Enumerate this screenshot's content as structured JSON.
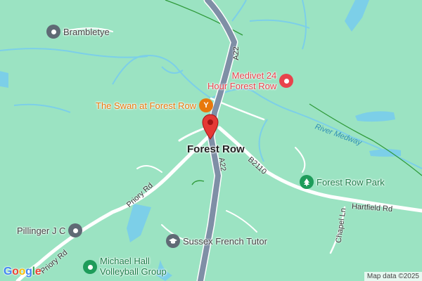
{
  "colors": {
    "land": "#9be3c2",
    "water": "#7ccfe8",
    "road": "#ffffff",
    "arterial": "#7f8fa6",
    "poi_gray": "#5f6a75",
    "poi_red": "#e8434c",
    "poi_orange": "#e8780c",
    "poi_green": "#1e9c5a",
    "pin": "#e53935"
  },
  "places": {
    "brambletye": "Brambletye",
    "medivet": "Medivet 24\nHour Forest Row",
    "swan": "The Swan at Forest Row",
    "forest_row_park": "Forest Row Park",
    "pillinger": "Pillinger J C",
    "sussex_french_tutor": "Sussex French Tutor",
    "michael_hall": "Michael Hall\nVolleyball Group"
  },
  "icons": {
    "brambletye": "pin-gray-icon",
    "medivet": "pin-red-icon",
    "swan": "cocktail-icon",
    "forest_row_park": "tree-icon",
    "pillinger": "pin-gray-icon",
    "sussex_french_tutor": "mortarboard-icon",
    "michael_hall": "pin-green-icon"
  },
  "town": "Forest Row",
  "roads": {
    "a22_north": "A22",
    "a22_south": "A22",
    "b2110": "B2110",
    "hartfield_rd": "Hartfield Rd",
    "priory_rd_1": "Priory Rd",
    "priory_rd_2": "Priory Rd",
    "chapel_ln": "Chapel Ln"
  },
  "river": "River Medway",
  "brand": {
    "letters": [
      "G",
      "o",
      "o",
      "g",
      "l",
      "e"
    ],
    "colors": [
      "#4285F4",
      "#EA4335",
      "#FBBC05",
      "#4285F4",
      "#34A853",
      "#EA4335"
    ]
  },
  "attribution": "Map data ©2025"
}
